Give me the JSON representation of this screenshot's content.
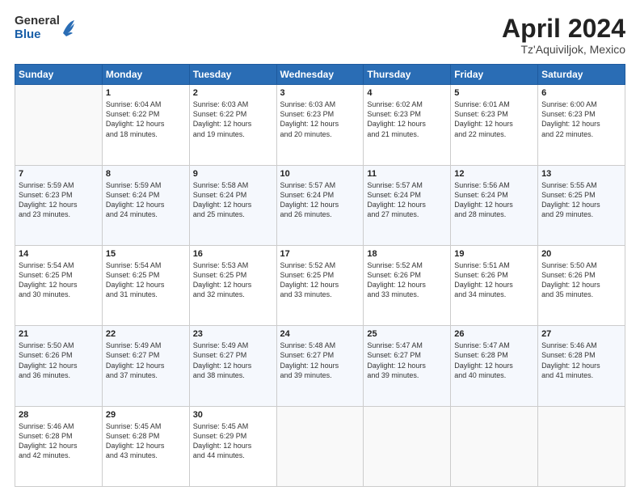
{
  "header": {
    "logo_general": "General",
    "logo_blue": "Blue",
    "title": "April 2024",
    "subtitle": "Tz'Aquiviljok, Mexico"
  },
  "days_of_week": [
    "Sunday",
    "Monday",
    "Tuesday",
    "Wednesday",
    "Thursday",
    "Friday",
    "Saturday"
  ],
  "weeks": [
    [
      {
        "day": "",
        "detail": ""
      },
      {
        "day": "1",
        "detail": "Sunrise: 6:04 AM\nSunset: 6:22 PM\nDaylight: 12 hours\nand 18 minutes."
      },
      {
        "day": "2",
        "detail": "Sunrise: 6:03 AM\nSunset: 6:22 PM\nDaylight: 12 hours\nand 19 minutes."
      },
      {
        "day": "3",
        "detail": "Sunrise: 6:03 AM\nSunset: 6:23 PM\nDaylight: 12 hours\nand 20 minutes."
      },
      {
        "day": "4",
        "detail": "Sunrise: 6:02 AM\nSunset: 6:23 PM\nDaylight: 12 hours\nand 21 minutes."
      },
      {
        "day": "5",
        "detail": "Sunrise: 6:01 AM\nSunset: 6:23 PM\nDaylight: 12 hours\nand 22 minutes."
      },
      {
        "day": "6",
        "detail": "Sunrise: 6:00 AM\nSunset: 6:23 PM\nDaylight: 12 hours\nand 22 minutes."
      }
    ],
    [
      {
        "day": "7",
        "detail": "Sunrise: 5:59 AM\nSunset: 6:23 PM\nDaylight: 12 hours\nand 23 minutes."
      },
      {
        "day": "8",
        "detail": "Sunrise: 5:59 AM\nSunset: 6:24 PM\nDaylight: 12 hours\nand 24 minutes."
      },
      {
        "day": "9",
        "detail": "Sunrise: 5:58 AM\nSunset: 6:24 PM\nDaylight: 12 hours\nand 25 minutes."
      },
      {
        "day": "10",
        "detail": "Sunrise: 5:57 AM\nSunset: 6:24 PM\nDaylight: 12 hours\nand 26 minutes."
      },
      {
        "day": "11",
        "detail": "Sunrise: 5:57 AM\nSunset: 6:24 PM\nDaylight: 12 hours\nand 27 minutes."
      },
      {
        "day": "12",
        "detail": "Sunrise: 5:56 AM\nSunset: 6:24 PM\nDaylight: 12 hours\nand 28 minutes."
      },
      {
        "day": "13",
        "detail": "Sunrise: 5:55 AM\nSunset: 6:25 PM\nDaylight: 12 hours\nand 29 minutes."
      }
    ],
    [
      {
        "day": "14",
        "detail": "Sunrise: 5:54 AM\nSunset: 6:25 PM\nDaylight: 12 hours\nand 30 minutes."
      },
      {
        "day": "15",
        "detail": "Sunrise: 5:54 AM\nSunset: 6:25 PM\nDaylight: 12 hours\nand 31 minutes."
      },
      {
        "day": "16",
        "detail": "Sunrise: 5:53 AM\nSunset: 6:25 PM\nDaylight: 12 hours\nand 32 minutes."
      },
      {
        "day": "17",
        "detail": "Sunrise: 5:52 AM\nSunset: 6:25 PM\nDaylight: 12 hours\nand 33 minutes."
      },
      {
        "day": "18",
        "detail": "Sunrise: 5:52 AM\nSunset: 6:26 PM\nDaylight: 12 hours\nand 33 minutes."
      },
      {
        "day": "19",
        "detail": "Sunrise: 5:51 AM\nSunset: 6:26 PM\nDaylight: 12 hours\nand 34 minutes."
      },
      {
        "day": "20",
        "detail": "Sunrise: 5:50 AM\nSunset: 6:26 PM\nDaylight: 12 hours\nand 35 minutes."
      }
    ],
    [
      {
        "day": "21",
        "detail": "Sunrise: 5:50 AM\nSunset: 6:26 PM\nDaylight: 12 hours\nand 36 minutes."
      },
      {
        "day": "22",
        "detail": "Sunrise: 5:49 AM\nSunset: 6:27 PM\nDaylight: 12 hours\nand 37 minutes."
      },
      {
        "day": "23",
        "detail": "Sunrise: 5:49 AM\nSunset: 6:27 PM\nDaylight: 12 hours\nand 38 minutes."
      },
      {
        "day": "24",
        "detail": "Sunrise: 5:48 AM\nSunset: 6:27 PM\nDaylight: 12 hours\nand 39 minutes."
      },
      {
        "day": "25",
        "detail": "Sunrise: 5:47 AM\nSunset: 6:27 PM\nDaylight: 12 hours\nand 39 minutes."
      },
      {
        "day": "26",
        "detail": "Sunrise: 5:47 AM\nSunset: 6:28 PM\nDaylight: 12 hours\nand 40 minutes."
      },
      {
        "day": "27",
        "detail": "Sunrise: 5:46 AM\nSunset: 6:28 PM\nDaylight: 12 hours\nand 41 minutes."
      }
    ],
    [
      {
        "day": "28",
        "detail": "Sunrise: 5:46 AM\nSunset: 6:28 PM\nDaylight: 12 hours\nand 42 minutes."
      },
      {
        "day": "29",
        "detail": "Sunrise: 5:45 AM\nSunset: 6:28 PM\nDaylight: 12 hours\nand 43 minutes."
      },
      {
        "day": "30",
        "detail": "Sunrise: 5:45 AM\nSunset: 6:29 PM\nDaylight: 12 hours\nand 44 minutes."
      },
      {
        "day": "",
        "detail": ""
      },
      {
        "day": "",
        "detail": ""
      },
      {
        "day": "",
        "detail": ""
      },
      {
        "day": "",
        "detail": ""
      }
    ]
  ]
}
